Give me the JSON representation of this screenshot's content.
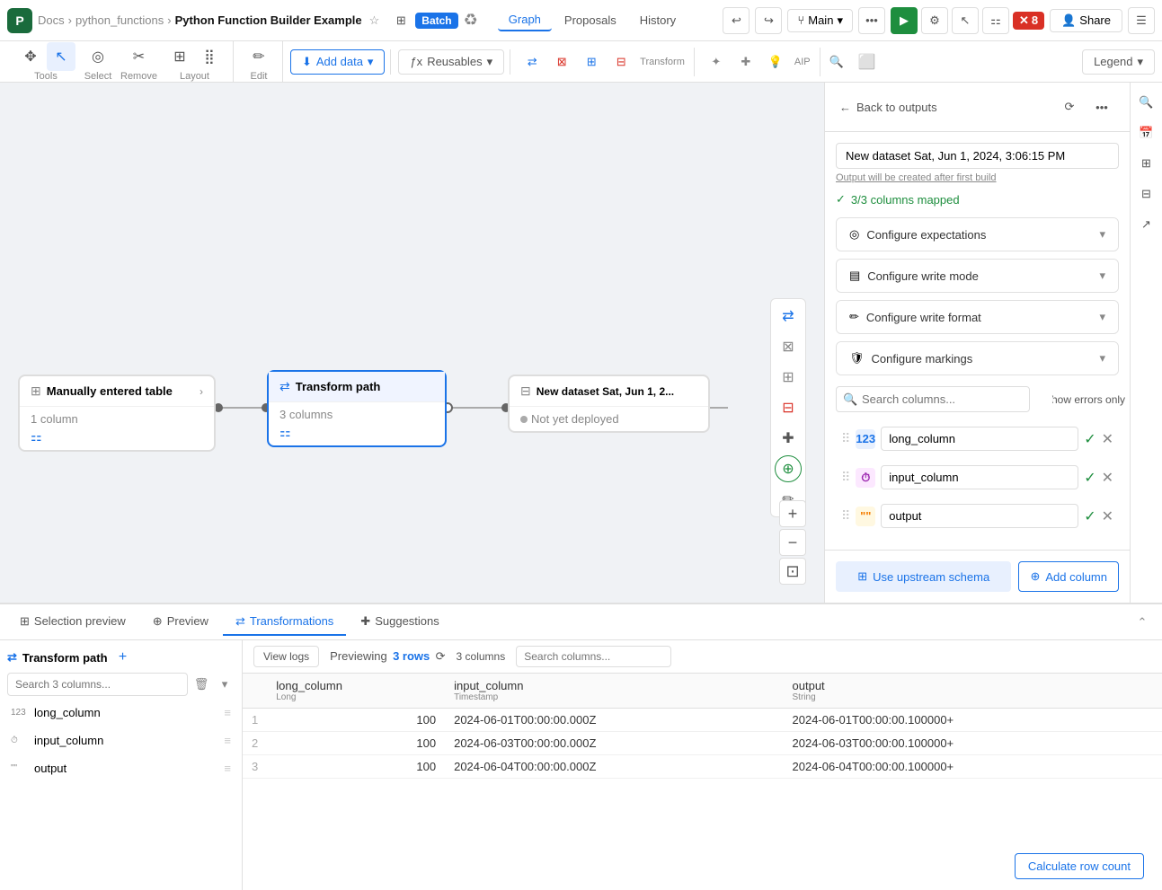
{
  "topbar": {
    "logo": "P",
    "breadcrumb": [
      "Docs",
      "python_functions",
      "Python Function Builder Example"
    ],
    "star": "☆",
    "batch_label": "Batch",
    "nav": [
      "Graph",
      "Proposals",
      "History"
    ],
    "active_nav": "Graph",
    "branch": "Main",
    "error_count": "8",
    "share_label": "Share"
  },
  "toolbar": {
    "tools_label": "Tools",
    "select_label": "Select",
    "remove_label": "Remove",
    "layout_label": "Layout",
    "edit_label": "Edit",
    "add_data_label": "Add data",
    "reusables_label": "Reusables",
    "transform_label": "Transform",
    "aip_label": "AIP",
    "legend_label": "Legend"
  },
  "canvas": {
    "manually_node": {
      "title": "Manually entered table",
      "subtitle": "1 column"
    },
    "transform_node": {
      "title": "Transform path",
      "subtitle": "3 columns"
    },
    "output_node": {
      "title": "New dataset Sat, Jun 1, 2...",
      "status": "Not yet deployed"
    }
  },
  "right_panel": {
    "back_label": "Back to outputs",
    "dataset_name": "New dataset Sat, Jun 1, 2024, 3:06:15 PM",
    "output_will_create": "Output will be created after first build",
    "columns_mapped": "3/3 columns mapped",
    "config_sections": [
      {
        "icon": "◎",
        "title": "Configure expectations"
      },
      {
        "icon": "▤",
        "title": "Configure write mode"
      },
      {
        "icon": "✏",
        "title": "Configure write format"
      },
      {
        "icon": "🛡",
        "title": "Configure markings"
      }
    ],
    "search_placeholder": "Search columns...",
    "show_errors_label": "Show errors only",
    "columns": [
      {
        "type": "123",
        "type_class": "number",
        "name": "long_column"
      },
      {
        "type": "⏱",
        "type_class": "time",
        "name": "input_column"
      },
      {
        "type": "\"\"",
        "type_class": "quote",
        "name": "output"
      }
    ],
    "use_upstream_label": "Use upstream schema",
    "add_column_label": "Add column"
  },
  "bottom_panel": {
    "tabs": [
      "Selection preview",
      "Preview",
      "Transformations",
      "Suggestions"
    ],
    "active_tab": "Transformations",
    "transform_path_label": "Transform path",
    "search_cols_placeholder": "Search 3 columns...",
    "columns": [
      {
        "type": "123",
        "name": "long_column"
      },
      {
        "type": "⏱",
        "name": "input_column"
      },
      {
        "type": "\"\"",
        "name": "output"
      }
    ],
    "view_logs_label": "View logs",
    "previewing_label": "Previewing",
    "previewing_count": "3 rows",
    "col_count": "3 columns",
    "search_right_placeholder": "Search columns...",
    "table": {
      "headers": [
        {
          "name": "long_column",
          "type": "Long"
        },
        {
          "name": "input_column",
          "type": "Timestamp"
        },
        {
          "name": "output",
          "type": "String"
        }
      ],
      "rows": [
        {
          "num": "1",
          "col1": "100",
          "col2": "2024-06-01T00:00:00.000Z",
          "col3": "2024-06-01T00:00:00.100000+"
        },
        {
          "num": "2",
          "col1": "100",
          "col2": "2024-06-03T00:00:00.000Z",
          "col3": "2024-06-03T00:00:00.100000+"
        },
        {
          "num": "3",
          "col1": "100",
          "col2": "2024-06-04T00:00:00.000Z",
          "col3": "2024-06-04T00:00:00.100000+"
        }
      ]
    },
    "calculate_row_btn": "Calculate row count"
  }
}
